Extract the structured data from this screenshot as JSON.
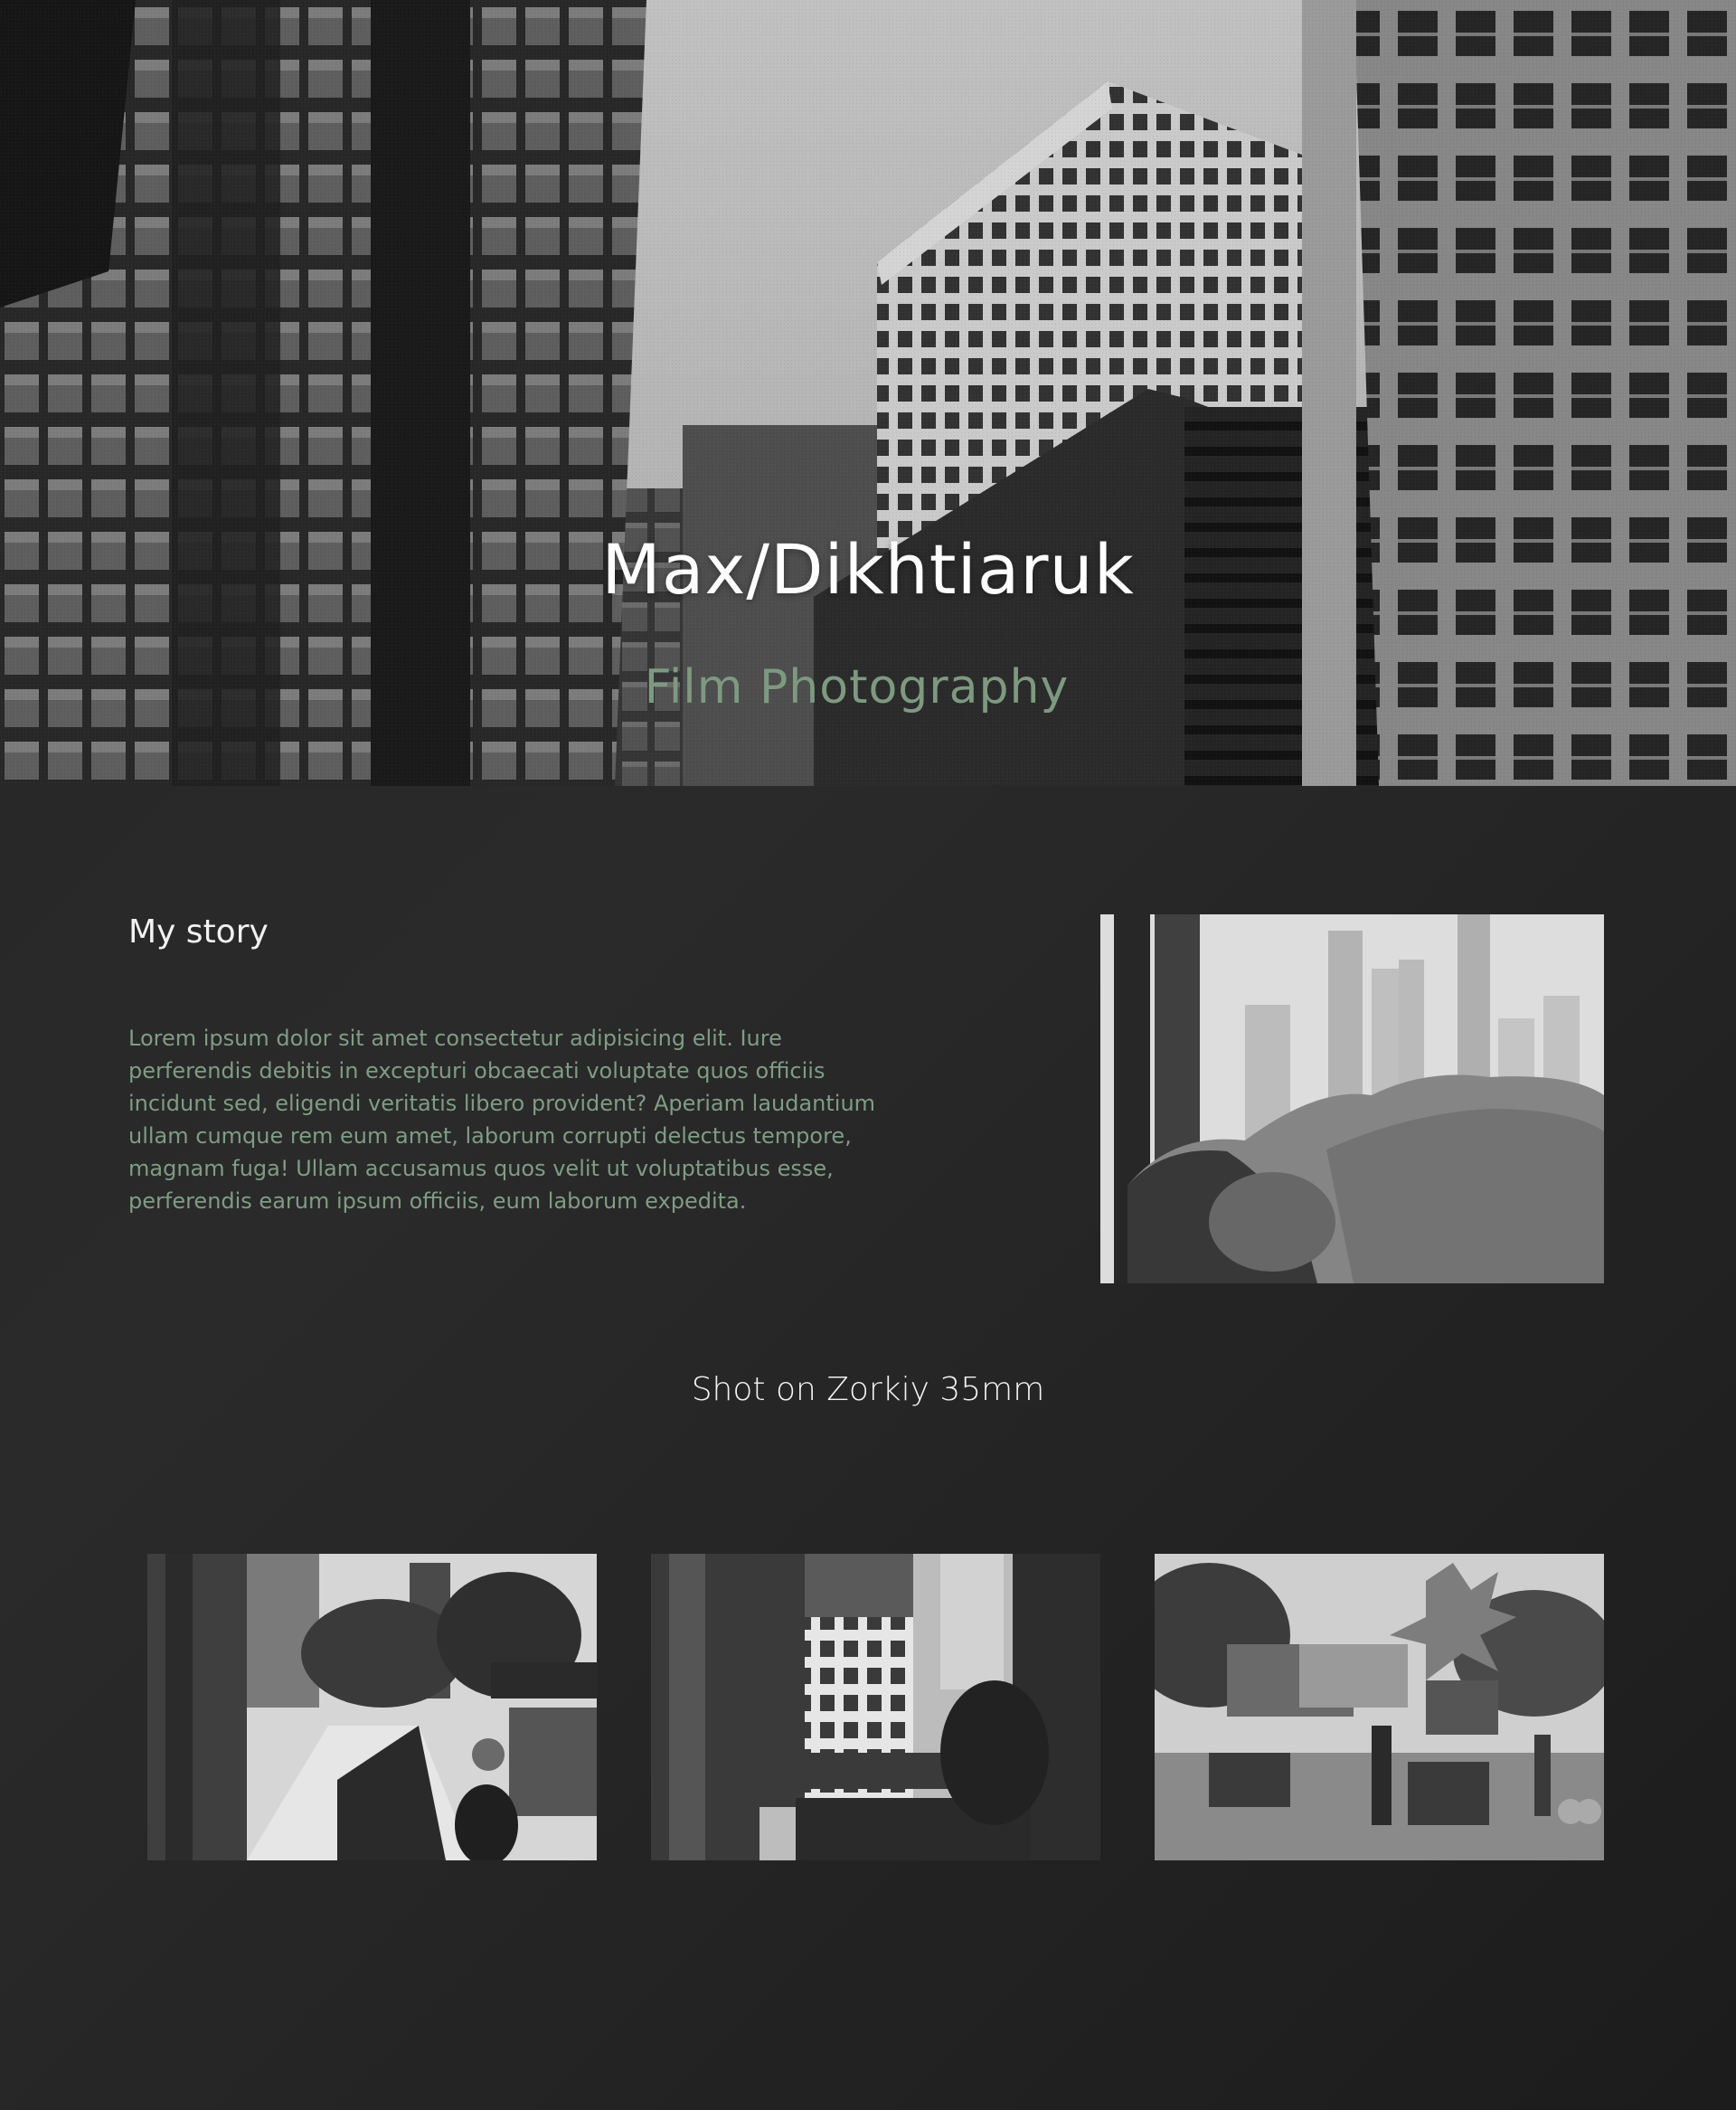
{
  "hero": {
    "title": "Max/Dikhtiaruk",
    "subtitle": "Film Photography",
    "image_description": "black-and-white-city-skyscrapers"
  },
  "story": {
    "heading": "My story",
    "body": "Lorem ipsum dolor sit amet consectetur adipisicing elit. Iure perferendis debitis in excepturi obcaecati voluptate quos officiis incidunt sed, eligendi veritatis libero provident? Aperiam laudantium ullam cumque rem eum amet, laborum corrupti delectus tempore, magnam fuga! Ullam accusamus quos velit ut voluptatibus esse, perferendis earum ipsum officiis, eum laborum expedita."
  },
  "gallery": {
    "heading": "Shot on Zorkiy 35mm"
  },
  "colors": {
    "accent_green": "#7d9a80",
    "background": "#262626",
    "heading_white": "#f2f2f2"
  }
}
